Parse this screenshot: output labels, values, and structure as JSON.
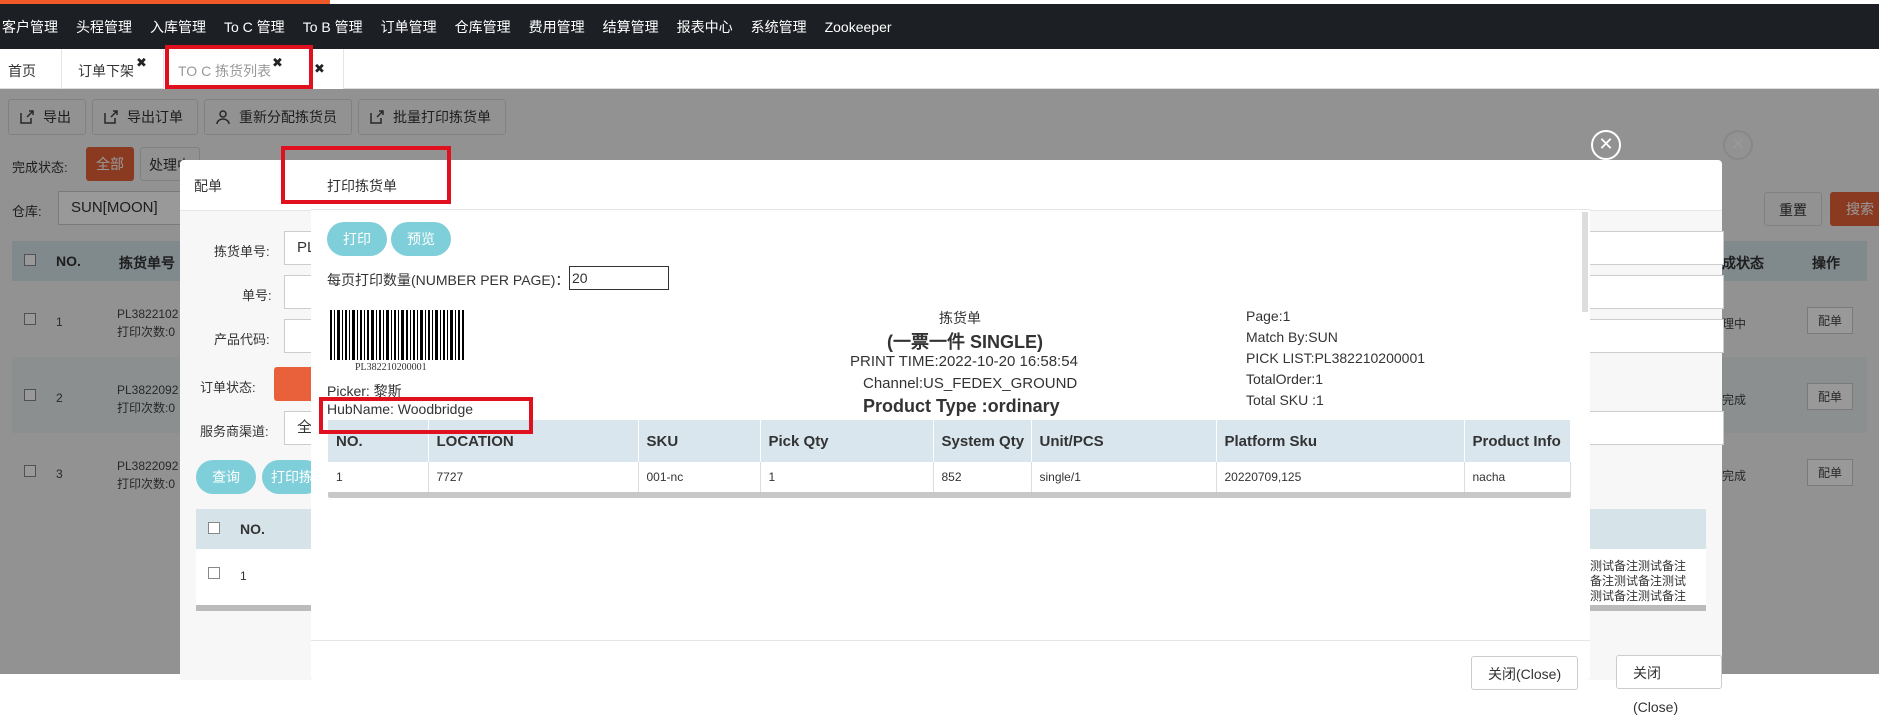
{
  "nav": {
    "items": [
      "客户管理",
      "头程管理",
      "入库管理",
      "To C 管理",
      "To B 管理",
      "订单管理",
      "仓库管理",
      "费用管理",
      "结算管理",
      "报表中心",
      "系统管理",
      "Zookeeper"
    ]
  },
  "tabs": [
    {
      "label": "首页"
    },
    {
      "label": "订单下架"
    },
    {
      "label": "TO C 拣货列表"
    }
  ],
  "toolbar": {
    "export": "导出",
    "export_orders": "导出订单",
    "reassign": "重新分配拣货员",
    "batch_print": "批量打印拣货单"
  },
  "filters": {
    "status_label": "完成状态:",
    "all": "全部",
    "processing": "处理中",
    "warehouse_label": "仓库:",
    "warehouse_value": "SUN[MOON]",
    "reset": "重置",
    "search": "搜索"
  },
  "table": {
    "headers": [
      "NO.",
      "拣货单号",
      "成状态",
      "操作"
    ],
    "rows": [
      {
        "no": "1",
        "code": "PL3822102",
        "print_count": "打印次数:0",
        "status": "理中",
        "action": "配单"
      },
      {
        "no": "2",
        "code": "PL3822092",
        "print_count": "打印次数:0",
        "status": "完成",
        "action": "配单"
      },
      {
        "no": "3",
        "code": "PL3822092",
        "print_count": "打印次数:0",
        "status": "完成",
        "action": "配单"
      }
    ]
  },
  "modal1": {
    "title": "配单",
    "pick_no_label": "拣货单号:",
    "pick_no_value": "PL",
    "order_no_label": "单号:",
    "product_code_label": "产品代码:",
    "order_status_label": "订单状态:",
    "channel_label": "服务商渠道:",
    "channel_value": "全",
    "query": "查询",
    "print": "打印拣",
    "subtable_no": "NO.",
    "subtable_row_no": "1",
    "notes": [
      "测试备注测试备注",
      "试备注测试备注测试",
      "备注测试备注测试备注"
    ],
    "close": "关闭(Close)"
  },
  "modal2": {
    "title": "打印拣货单",
    "print_btn": "打印",
    "preview_btn": "预览",
    "per_page_label": "每页打印数量(NUMBER PER PAGE)：",
    "per_page_value": "20",
    "barcode_text": "PL382210200001",
    "picker": "Picker: 黎斯",
    "hubname": "HubName: Woodbridge",
    "doc_title": "拣货单",
    "doc_subtitle": "(一票一件 SINGLE)",
    "print_time": "PRINT TIME:2022-10-20 16:58:54",
    "channel": "Channel:US_FEDEX_GROUND",
    "product_type": "Product Type :ordinary",
    "page": "Page:1",
    "match_by": "Match By:SUN",
    "pick_list": "PICK LIST:PL382210200001",
    "total_order": "TotalOrder:1",
    "total_sku": "Total SKU :1",
    "columns": [
      "NO.",
      "LOCATION",
      "SKU",
      "Pick Qty",
      "System Qty",
      "Unit/PCS",
      "Platform Sku",
      "Product Info"
    ],
    "rows": [
      [
        "1",
        "7727",
        "001-nc",
        "1",
        "852",
        "single/1",
        "20220709,125",
        "nacha"
      ]
    ],
    "close": "关闭(Close)"
  },
  "colors": {
    "accent": "#f05a28",
    "teal": "#7fcfda",
    "highlight": "#e0101f"
  }
}
